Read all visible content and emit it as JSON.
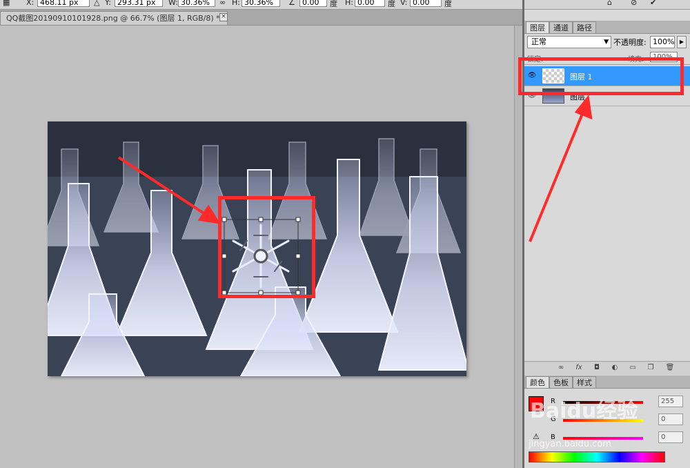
{
  "options_bar": {
    "x_label": "X:",
    "x_value": "468.11 px",
    "y_label": "Y:",
    "y_value": "293.31 px",
    "w_label": "W:",
    "w_value": "30.36%",
    "h_label": "H:",
    "h_value": "30.36%",
    "angle_value": "0.00",
    "angle_unit": "度",
    "hskew_label": "H:",
    "hskew_value": "0.00",
    "hskew_unit": "度",
    "vskew_label": "V:",
    "vskew_value": "0.00",
    "vskew_unit": "度"
  },
  "document": {
    "tab_title": "QQ截图20190910101928.png @ 66.7% (图层 1, RGB/8) *",
    "close_glyph": "×"
  },
  "layers_panel": {
    "tabs": [
      "图层",
      "通道",
      "路径"
    ],
    "blend_mode": "正常",
    "opacity_label": "不透明度:",
    "opacity_value": "100%",
    "lock_label": "锁定:",
    "fill_label": "填充:",
    "fill_value": "100%",
    "layers": [
      {
        "name": "图层 1",
        "selected": true
      },
      {
        "name": "图层",
        "selected": false
      }
    ]
  },
  "color_panel": {
    "tabs": [
      "颜色",
      "色板",
      "样式"
    ],
    "r_label": "R",
    "r_value": "255",
    "g_label": "G",
    "g_value": "0",
    "b_label": "B",
    "b_value": "0",
    "foreground_color": "#ff0000"
  },
  "watermark": {
    "text": "Baidu经验",
    "url": "jingyan.baidu.com"
  },
  "colors": {
    "annotation_red": "#ff2a2a",
    "selected_layer": "#3399ff"
  }
}
